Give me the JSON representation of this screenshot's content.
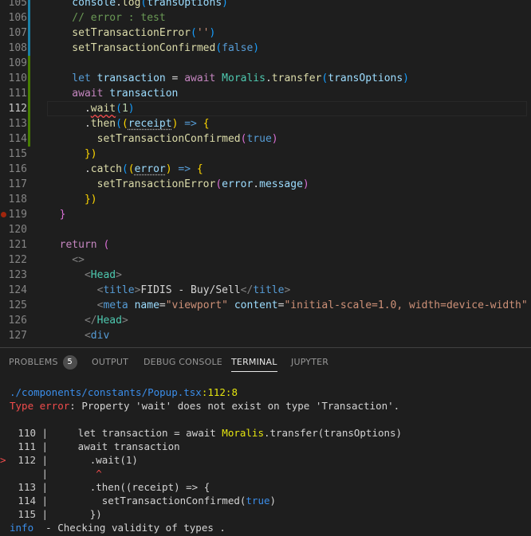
{
  "editor": {
    "lines": [
      {
        "num": "105",
        "tokens": [
          [
            "v",
            "    console"
          ],
          [
            "txt",
            "."
          ],
          [
            "f",
            "log"
          ],
          [
            "p3",
            "("
          ],
          [
            "v",
            "transOptions"
          ],
          [
            "p3",
            ")"
          ]
        ]
      },
      {
        "num": "106",
        "tokens": [
          [
            "c",
            "    // error : test"
          ]
        ]
      },
      {
        "num": "107",
        "tokens": [
          [
            "f",
            "    setTransactionError"
          ],
          [
            "p3",
            "("
          ],
          [
            "s",
            "''"
          ],
          [
            "p3",
            ")"
          ]
        ]
      },
      {
        "num": "108",
        "tokens": [
          [
            "f",
            "    setTransactionConfirmed"
          ],
          [
            "p3",
            "("
          ],
          [
            "k",
            "false"
          ],
          [
            "p3",
            ")"
          ]
        ]
      },
      {
        "num": "109",
        "tokens": []
      },
      {
        "num": "110",
        "tokens": [
          [
            "k",
            "    let "
          ],
          [
            "v",
            "transaction"
          ],
          [
            "txt",
            " = "
          ],
          [
            "kc",
            "await "
          ],
          [
            "t",
            "Moralis"
          ],
          [
            "txt",
            "."
          ],
          [
            "f",
            "transfer"
          ],
          [
            "p3",
            "("
          ],
          [
            "v",
            "transOptions"
          ],
          [
            "p3",
            ")"
          ]
        ]
      },
      {
        "num": "111",
        "tokens": [
          [
            "kc",
            "    await "
          ],
          [
            "v",
            "transaction"
          ]
        ]
      },
      {
        "num": "112",
        "tokens": [
          [
            "txt",
            "      ."
          ],
          [
            "fsq",
            "wait"
          ],
          [
            "p3",
            "("
          ],
          [
            "n",
            "1"
          ],
          [
            "p3",
            ")"
          ]
        ]
      },
      {
        "num": "113",
        "tokens": [
          [
            "txt",
            "      ."
          ],
          [
            "f",
            "then"
          ],
          [
            "p3",
            "("
          ],
          [
            "p1",
            "("
          ],
          [
            "vsq",
            "receipt"
          ],
          [
            "p1",
            ")"
          ],
          [
            "txt",
            " "
          ],
          [
            "k",
            "=>"
          ],
          [
            "txt",
            " "
          ],
          [
            "p1",
            "{"
          ]
        ]
      },
      {
        "num": "114",
        "tokens": [
          [
            "f",
            "        setTransactionConfirmed"
          ],
          [
            "p2",
            "("
          ],
          [
            "k",
            "true"
          ],
          [
            "p2",
            ")"
          ]
        ]
      },
      {
        "num": "115",
        "tokens": [
          [
            "p1",
            "      })"
          ]
        ]
      },
      {
        "num": "116",
        "tokens": [
          [
            "txt",
            "      ."
          ],
          [
            "f",
            "catch"
          ],
          [
            "p3",
            "("
          ],
          [
            "p1",
            "("
          ],
          [
            "vsq",
            "error"
          ],
          [
            "p1",
            ")"
          ],
          [
            "txt",
            " "
          ],
          [
            "k",
            "=>"
          ],
          [
            "txt",
            " "
          ],
          [
            "p1",
            "{"
          ]
        ]
      },
      {
        "num": "117",
        "tokens": [
          [
            "f",
            "        setTransactionError"
          ],
          [
            "p2",
            "("
          ],
          [
            "v",
            "error"
          ],
          [
            "txt",
            "."
          ],
          [
            "v",
            "message"
          ],
          [
            "p2",
            ")"
          ]
        ]
      },
      {
        "num": "118",
        "tokens": [
          [
            "p1",
            "      })"
          ]
        ]
      },
      {
        "num": "119",
        "tokens": [
          [
            "p2",
            "  }"
          ]
        ]
      },
      {
        "num": "120",
        "tokens": []
      },
      {
        "num": "121",
        "tokens": [
          [
            "kc",
            "  return "
          ],
          [
            "p2",
            "("
          ]
        ]
      },
      {
        "num": "122",
        "tokens": [
          [
            "pun",
            "    <>"
          ]
        ]
      },
      {
        "num": "123",
        "tokens": [
          [
            "pun",
            "      <"
          ],
          [
            "jt",
            "Head"
          ],
          [
            "pun",
            ">"
          ]
        ]
      },
      {
        "num": "124",
        "tokens": [
          [
            "pun",
            "        <"
          ],
          [
            "tag",
            "title"
          ],
          [
            "pun",
            ">"
          ],
          [
            "txt",
            "FIDIS - Buy/Sell"
          ],
          [
            "pun",
            "</"
          ],
          [
            "tag",
            "title"
          ],
          [
            "pun",
            ">"
          ]
        ]
      },
      {
        "num": "125",
        "tokens": [
          [
            "pun",
            "        <"
          ],
          [
            "tag",
            "meta"
          ],
          [
            "txt",
            " "
          ],
          [
            "v",
            "name"
          ],
          [
            "txt",
            "="
          ],
          [
            "s",
            "\"viewport\""
          ],
          [
            "txt",
            " "
          ],
          [
            "v",
            "content"
          ],
          [
            "txt",
            "="
          ],
          [
            "s",
            "\"initial-scale=1.0, width=device-width\""
          ],
          [
            "txt",
            " /"
          ]
        ]
      },
      {
        "num": "126",
        "tokens": [
          [
            "pun",
            "      </"
          ],
          [
            "jt",
            "Head"
          ],
          [
            "pun",
            ">"
          ]
        ]
      },
      {
        "num": "127",
        "tokens": [
          [
            "pun",
            "      <"
          ],
          [
            "tag",
            "div"
          ]
        ]
      }
    ]
  },
  "panel": {
    "tabs": [
      {
        "label": "PROBLEMS",
        "badge": "5"
      },
      {
        "label": "OUTPUT"
      },
      {
        "label": "DEBUG CONSOLE"
      },
      {
        "label": "TERMINAL",
        "active": true
      },
      {
        "label": "JUPYTER"
      }
    ],
    "terminal": {
      "path": "./components/constants/Popup.tsx",
      "pos": ":112:8",
      "err_label": "Type error",
      "err_msg": ": Property 'wait' does not exist on type 'Transaction'.",
      "snippet": [
        {
          "marker": "",
          "num": "110",
          "code": "    let transaction = await ",
          "cls": "Moralis",
          ".": "",
          "rest": ".transfer(transOptions)"
        },
        {
          "marker": "",
          "num": "111",
          "code": "    await transaction"
        },
        {
          "marker": ">",
          "num": "112",
          "code": "      .wait(1)"
        },
        {
          "marker": "",
          "num": "",
          "code": "       ^"
        },
        {
          "marker": "",
          "num": "113",
          "code": "      .then((receipt) => {"
        },
        {
          "marker": "",
          "num": "114",
          "code": "        setTransactionConfirmed(",
          "kw": "true",
          "tail": ")"
        },
        {
          "marker": "",
          "num": "115",
          "code": "      })"
        }
      ],
      "info_label": "info",
      "info_msg": "  - Checking validity of types ."
    }
  },
  "colors": {
    "bg": "#1e1e1e",
    "accent": "#3b8eea",
    "error": "#f14c4c"
  }
}
